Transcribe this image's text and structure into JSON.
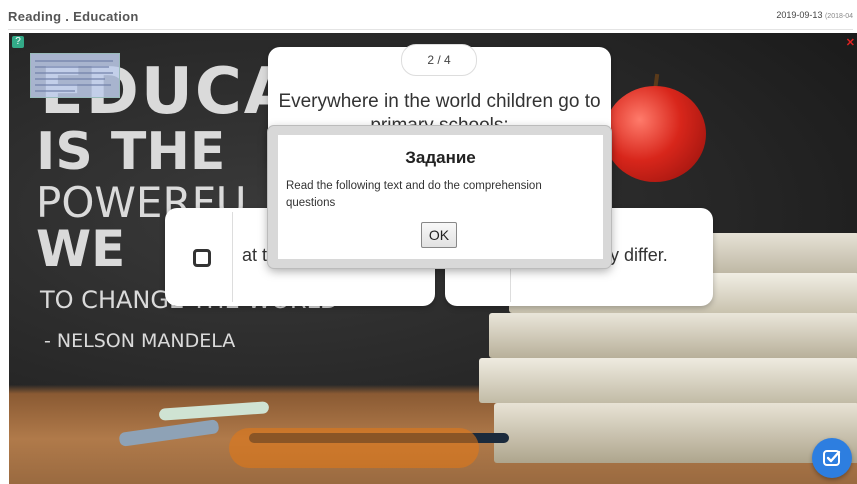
{
  "header": {
    "title": "Reading . Education",
    "date": "2019-09-13",
    "date_extra": "(2018-04"
  },
  "background": {
    "quote_lines": [
      "EDUCA",
      "IS THE",
      "POWERFU",
      "WE",
      "TO CHANGE THE WORLD"
    ],
    "author": "- NELSON MANDELA"
  },
  "question": {
    "counter": "2 / 4",
    "text": "Everywhere in the world children go to primary schools;"
  },
  "answers": [
    {
      "text": "at t"
    },
    {
      "text": "ay differ."
    }
  ],
  "modal": {
    "title": "Задание",
    "body": "Read the following text and do the comprehension questions",
    "ok_label": "OK"
  },
  "icons": {
    "corner": "help-icon",
    "close": "close-icon",
    "fab": "check-icon"
  },
  "colors": {
    "accent": "#2d7ee0"
  }
}
